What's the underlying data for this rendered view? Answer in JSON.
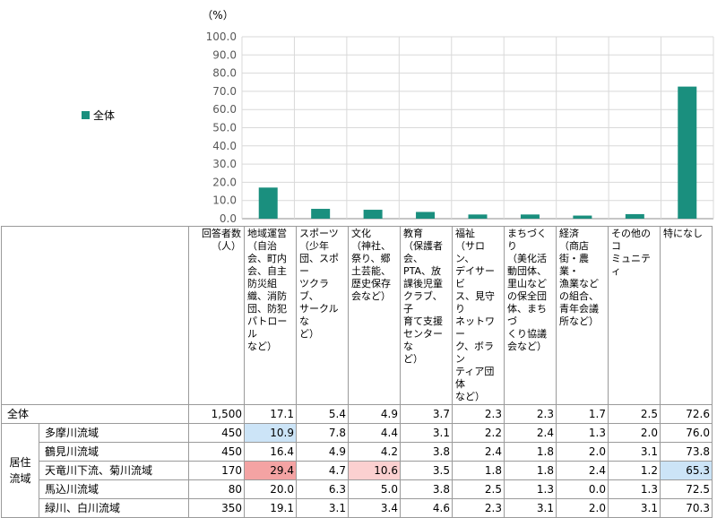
{
  "chart_data": {
    "type": "bar",
    "unit_label": "（%）",
    "ylim": [
      0,
      100
    ],
    "yticks": [
      "0.0",
      "10.0",
      "20.0",
      "30.0",
      "40.0",
      "50.0",
      "60.0",
      "70.0",
      "80.0",
      "90.0",
      "100.0"
    ],
    "series": [
      {
        "name": "全体",
        "color": "#1a8f7e",
        "values": [
          17.1,
          5.4,
          4.9,
          3.7,
          2.3,
          2.3,
          1.7,
          2.5,
          72.6
        ]
      }
    ],
    "categories": [
      "地域運営（自治会、町内会、自主防災組織、消防団、防犯パトロールなど）",
      "スポーツ（少年団、スポーツクラブ、サークルなど）",
      "文化（神社、祭り、郷土芸能、歴史保存会など）",
      "教育（保護者会、PTA、放課後児童クラブ、子育て支援センターなど）",
      "福祉（サロン、デイサービス、見守りネットワーク、ボランティア団体など）",
      "まちづくり（美化活動団体、里山などの保全団体、まちづくり協議会など）",
      "経済（商店街・農業・漁業などの組合、青年会議所など）",
      "その他のコミュニティ",
      "特になし"
    ]
  },
  "table": {
    "headers": {
      "n": "回答者数\n（人）",
      "cols": [
        "地域運営\n（自治\n会、町内\n会、自主\n防災組\n織、消防\n団、防犯\nパトロール\nなど）",
        "スポーツ\n（少年\n団、スポー\nツクラブ、\nサークルな\nど）",
        "文化\n（神社、\n祭り、郷\n土芸能、\n歴史保存\n会など）",
        "教育\n（保護者\n会、\nPTA、放\n課後児童\nクラブ、子\n育て支援\nセンターな\nど）",
        "福祉\n（サロン、\nデイサービ\nス、見守り\nネットワー\nク、ボラン\nティア団体\nなど）",
        "まちづくり\n（美化活\n動団体、\n里山など\nの保全団\n体、まちづ\nくり協議\n会など）",
        "経済\n（商店\n街・農業・\n漁業など\nの組合、\n青年会議\n所など）",
        "その他のコ\nミュニティ",
        "特になし"
      ]
    },
    "total_row": {
      "label": "全体",
      "n": "1,500",
      "values": [
        "17.1",
        "5.4",
        "4.9",
        "3.7",
        "2.3",
        "2.3",
        "1.7",
        "2.5",
        "72.6"
      ]
    },
    "group_label": "居住\n流域",
    "rows": [
      {
        "label": "多摩川流域",
        "n": "450",
        "values": [
          "10.9",
          "7.8",
          "4.4",
          "3.1",
          "2.2",
          "2.4",
          "1.3",
          "2.0",
          "76.0"
        ],
        "highlights": {
          "0": "#cce4f7"
        }
      },
      {
        "label": "鶴見川流域",
        "n": "450",
        "values": [
          "16.4",
          "4.9",
          "4.2",
          "3.8",
          "2.4",
          "1.8",
          "2.0",
          "3.1",
          "73.8"
        ],
        "highlights": {}
      },
      {
        "label": "天竜川下流、菊川流域",
        "n": "170",
        "values": [
          "29.4",
          "4.7",
          "10.6",
          "3.5",
          "1.8",
          "1.8",
          "2.4",
          "1.2",
          "65.3"
        ],
        "highlights": {
          "0": "#f4a3a3",
          "2": "#fbd0d0",
          "8": "#cce4f7"
        }
      },
      {
        "label": "馬込川流域",
        "n": "80",
        "values": [
          "20.0",
          "6.3",
          "5.0",
          "3.8",
          "2.5",
          "1.3",
          "0.0",
          "1.3",
          "72.5"
        ],
        "highlights": {}
      },
      {
        "label": "緑川、白川流域",
        "n": "350",
        "values": [
          "19.1",
          "3.1",
          "3.4",
          "4.6",
          "2.3",
          "3.1",
          "2.0",
          "3.1",
          "70.3"
        ],
        "highlights": {}
      }
    ]
  }
}
